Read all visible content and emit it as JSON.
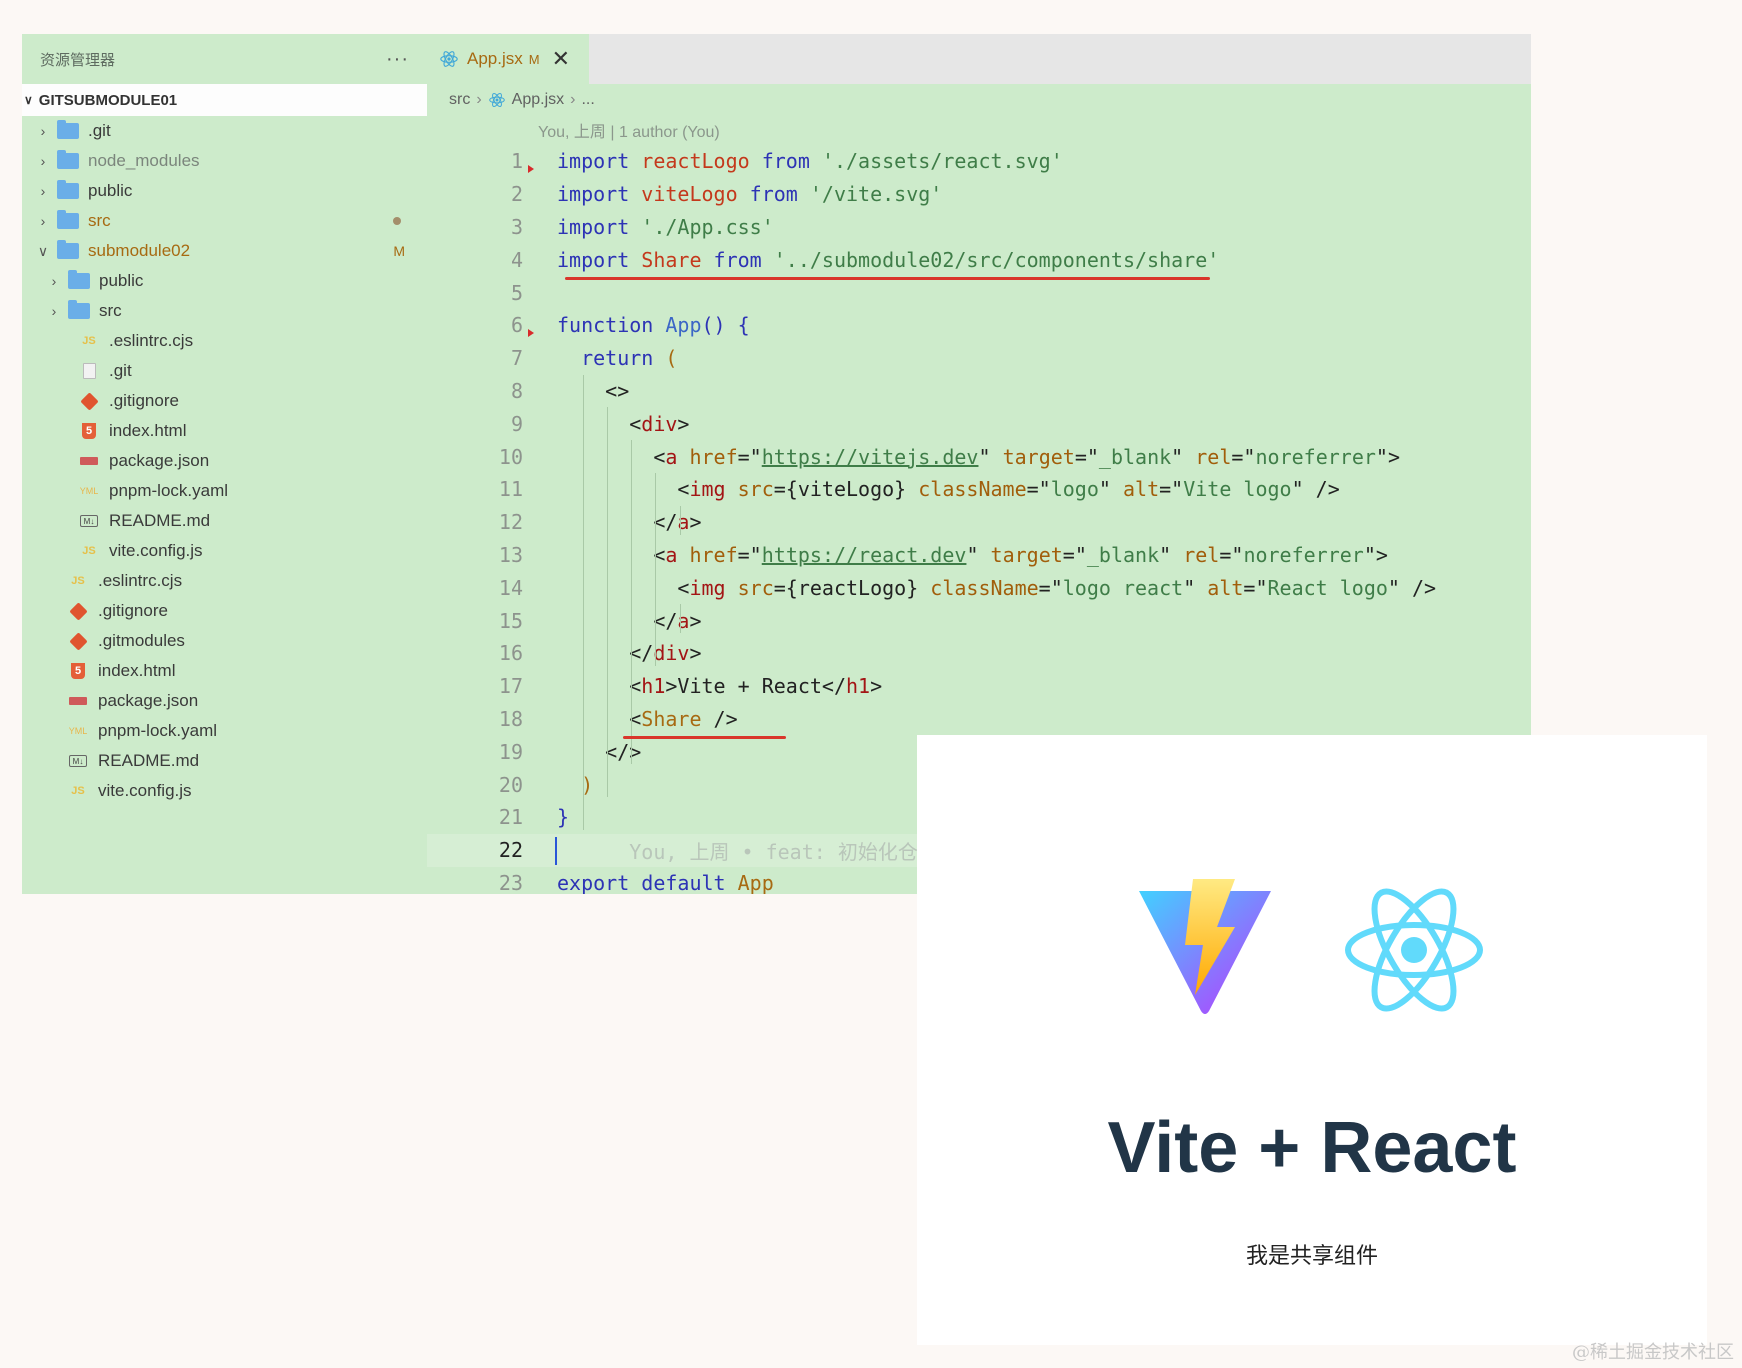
{
  "explorer": {
    "title": "资源管理器",
    "more": "···",
    "project": "GITSUBMODULE01",
    "items": [
      {
        "label": ".git",
        "type": "folder",
        "depth": 0,
        "style": "normal"
      },
      {
        "label": "node_modules",
        "type": "folder",
        "depth": 0,
        "style": "dim"
      },
      {
        "label": "public",
        "type": "folder",
        "depth": 0,
        "style": "normal"
      },
      {
        "label": "src",
        "type": "folder",
        "depth": 0,
        "style": "orange",
        "badge": "dot"
      },
      {
        "label": "submodule02",
        "type": "folder-open",
        "depth": 0,
        "style": "orange",
        "badge": "M"
      },
      {
        "label": "public",
        "type": "folder",
        "depth": 1,
        "style": "normal"
      },
      {
        "label": "src",
        "type": "folder",
        "depth": 1,
        "style": "normal"
      },
      {
        "label": ".eslintrc.cjs",
        "type": "js",
        "depth": 1,
        "style": "normal"
      },
      {
        "label": ".git",
        "type": "file",
        "depth": 1,
        "style": "normal"
      },
      {
        "label": ".gitignore",
        "type": "git",
        "depth": 1,
        "style": "normal"
      },
      {
        "label": "index.html",
        "type": "html",
        "depth": 1,
        "style": "normal"
      },
      {
        "label": "package.json",
        "type": "pkg",
        "depth": 1,
        "style": "normal"
      },
      {
        "label": "pnpm-lock.yaml",
        "type": "yaml",
        "depth": 1,
        "style": "normal"
      },
      {
        "label": "README.md",
        "type": "md",
        "depth": 1,
        "style": "normal"
      },
      {
        "label": "vite.config.js",
        "type": "js",
        "depth": 1,
        "style": "normal"
      },
      {
        "label": ".eslintrc.cjs",
        "type": "js",
        "depth": 0,
        "style": "normal"
      },
      {
        "label": ".gitignore",
        "type": "git",
        "depth": 0,
        "style": "normal"
      },
      {
        "label": ".gitmodules",
        "type": "git",
        "depth": 0,
        "style": "normal"
      },
      {
        "label": "index.html",
        "type": "html",
        "depth": 0,
        "style": "normal"
      },
      {
        "label": "package.json",
        "type": "pkg",
        "depth": 0,
        "style": "normal"
      },
      {
        "label": "pnpm-lock.yaml",
        "type": "yaml",
        "depth": 0,
        "style": "normal"
      },
      {
        "label": "README.md",
        "type": "md",
        "depth": 0,
        "style": "normal"
      },
      {
        "label": "vite.config.js",
        "type": "js",
        "depth": 0,
        "style": "normal"
      }
    ]
  },
  "editor": {
    "tab": {
      "label": "App.jsx",
      "modified": "M",
      "close": "✕"
    },
    "breadcrumb": {
      "folder": "src",
      "file": "App.jsx",
      "more": "..."
    },
    "blame": "You, 上周 | 1 author (You)",
    "current_line": 22,
    "lines": [
      [
        [
          "import ",
          "k"
        ],
        [
          "reactLogo ",
          "id"
        ],
        [
          "from ",
          "k"
        ],
        [
          "'./assets/react.svg'",
          "s"
        ]
      ],
      [
        [
          "import ",
          "k"
        ],
        [
          "viteLogo ",
          "id"
        ],
        [
          "from ",
          "k"
        ],
        [
          "'/vite.svg'",
          "s"
        ]
      ],
      [
        [
          "import ",
          "k"
        ],
        [
          "'./App.css'",
          "s"
        ]
      ],
      [
        [
          "import ",
          "k"
        ],
        [
          "Share ",
          "id"
        ],
        [
          "from ",
          "k"
        ],
        [
          "'../submodule02/src/components/share'",
          "s"
        ]
      ],
      [],
      [
        [
          "function ",
          "k"
        ],
        [
          "App",
          "fn"
        ],
        [
          "() {",
          "k"
        ]
      ],
      [
        [
          "  return ",
          "k"
        ],
        [
          "(",
          "c"
        ]
      ],
      [
        [
          "    <>",
          ""
        ]
      ],
      [
        [
          "      <",
          ""
        ],
        [
          "div",
          "tg"
        ],
        [
          ">",
          ""
        ]
      ],
      [
        [
          "        <",
          ""
        ],
        [
          "a ",
          "tg"
        ],
        [
          "href",
          "at"
        ],
        [
          "=\"",
          ""
        ],
        [
          "https://vitejs.dev",
          "su"
        ],
        [
          "\" ",
          ""
        ],
        [
          "target",
          "at"
        ],
        [
          "=\"",
          ""
        ],
        [
          "_blank",
          "s"
        ],
        [
          "\" ",
          ""
        ],
        [
          "rel",
          "at"
        ],
        [
          "=\"",
          ""
        ],
        [
          "noreferrer",
          "s"
        ],
        [
          "\">",
          ""
        ]
      ],
      [
        [
          "          <",
          ""
        ],
        [
          "img ",
          "tg"
        ],
        [
          "src",
          "at"
        ],
        [
          "={viteLogo} ",
          ""
        ],
        [
          "className",
          "at"
        ],
        [
          "=\"",
          ""
        ],
        [
          "logo",
          "s"
        ],
        [
          "\" ",
          ""
        ],
        [
          "alt",
          "at"
        ],
        [
          "=\"",
          ""
        ],
        [
          "Vite logo",
          "s"
        ],
        [
          "\" />",
          ""
        ]
      ],
      [
        [
          "        </",
          ""
        ],
        [
          "a",
          "tg"
        ],
        [
          ">",
          ""
        ]
      ],
      [
        [
          "        <",
          ""
        ],
        [
          "a ",
          "tg"
        ],
        [
          "href",
          "at"
        ],
        [
          "=\"",
          ""
        ],
        [
          "https://react.dev",
          "su"
        ],
        [
          "\" ",
          ""
        ],
        [
          "target",
          "at"
        ],
        [
          "=\"",
          ""
        ],
        [
          "_blank",
          "s"
        ],
        [
          "\" ",
          ""
        ],
        [
          "rel",
          "at"
        ],
        [
          "=\"",
          ""
        ],
        [
          "noreferrer",
          "s"
        ],
        [
          "\">",
          ""
        ]
      ],
      [
        [
          "          <",
          ""
        ],
        [
          "img ",
          "tg"
        ],
        [
          "src",
          "at"
        ],
        [
          "={reactLogo} ",
          ""
        ],
        [
          "className",
          "at"
        ],
        [
          "=\"",
          ""
        ],
        [
          "logo react",
          "s"
        ],
        [
          "\" ",
          ""
        ],
        [
          "alt",
          "at"
        ],
        [
          "=\"",
          ""
        ],
        [
          "React logo",
          "s"
        ],
        [
          "\" />",
          ""
        ]
      ],
      [
        [
          "        </",
          ""
        ],
        [
          "a",
          "tg"
        ],
        [
          ">",
          ""
        ]
      ],
      [
        [
          "      </",
          ""
        ],
        [
          "div",
          "tg"
        ],
        [
          ">",
          ""
        ]
      ],
      [
        [
          "      <",
          ""
        ],
        [
          "h1",
          "tg"
        ],
        [
          ">Vite + React</",
          ""
        ],
        [
          "h1",
          "tg"
        ],
        [
          ">",
          ""
        ]
      ],
      [
        [
          "      <",
          ""
        ],
        [
          "Share ",
          "c"
        ],
        [
          "/>",
          ""
        ]
      ],
      [
        [
          "    </>",
          ""
        ]
      ],
      [
        [
          "  )",
          "c"
        ]
      ],
      [
        [
          "}",
          "k"
        ]
      ],
      [
        [
          "      You, 上周 • feat: 初始化仓",
          "ghost"
        ]
      ],
      [
        [
          "export ",
          "k"
        ],
        [
          "default ",
          "k"
        ],
        [
          "App",
          "c"
        ]
      ]
    ]
  },
  "preview": {
    "title": "Vite + React",
    "share_text": "我是共享组件"
  },
  "watermark": "@稀土掘金技术社区",
  "colors": {
    "editor_bg": "#cdebcb",
    "annotation_red": "#d9362b",
    "vite_purple": "#a855f7",
    "vite_yellow": "#ffcb2b",
    "react_blue": "#61dafb"
  }
}
